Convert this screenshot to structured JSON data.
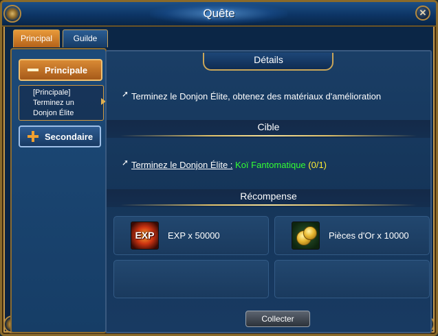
{
  "window": {
    "title": "Quête",
    "close_symbol": "✕"
  },
  "tabs": [
    {
      "label": "Principal",
      "active": true
    },
    {
      "label": "Guilde",
      "active": false
    }
  ],
  "sidebar": {
    "primary_category": {
      "label": "Principale",
      "icon": "minus-icon"
    },
    "quest_entry": {
      "line1": "[Principale]",
      "line2": "Terminez un",
      "line3": "Donjon Élite"
    },
    "secondary_category": {
      "label": "Secondaire",
      "icon": "plus-icon"
    }
  },
  "details": {
    "header": "Détails",
    "text": "Terminez le Donjon Élite, obtenez des matériaux d'amélioration"
  },
  "target": {
    "header": "Cible",
    "objective": "Terminez le Donjon Élite :",
    "monster": "Koï Fantomatique",
    "progress": "(0/1)"
  },
  "rewards": {
    "header": "Récompense",
    "items": [
      {
        "icon": "exp-icon",
        "icon_text": "EXP",
        "label": "EXP x 50000"
      },
      {
        "icon": "gold-coins-icon",
        "label": "Pièces d'Or x 10000"
      }
    ]
  },
  "actions": {
    "collect_label": "Collecter"
  },
  "colors": {
    "accent_orange": "#d98a34",
    "border_gold": "#c89a4a",
    "monster_green": "#33ff33",
    "progress_yellow": "#ffee33"
  }
}
